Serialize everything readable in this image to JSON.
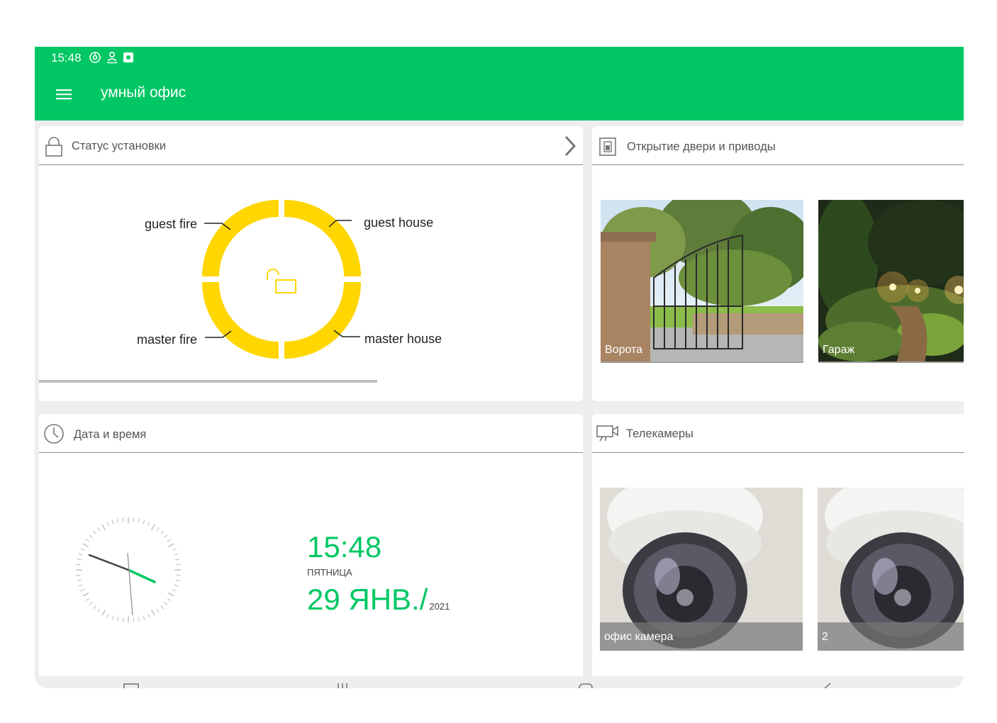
{
  "status_bar": {
    "time": "15:48",
    "icons": [
      "chrome-icon",
      "person-icon",
      "gallery-icon"
    ]
  },
  "app_bar": {
    "title": "умный офис",
    "menu_icon": "hamburger-menu-icon",
    "background": "#00c764"
  },
  "security_card": {
    "title": "Статус установки",
    "icon": "lock-icon",
    "chevron_icon": "chevron-right-icon",
    "ring_color": "#ffd600",
    "center_icon": "unlocked-padlock-icon",
    "zones": [
      "guest fire",
      "guest house",
      "master fire",
      "master house"
    ]
  },
  "doors_card": {
    "title": "Открытие двери и приводы",
    "icon": "door-icon",
    "tiles": [
      {
        "label": "Ворота"
      },
      {
        "label": "Гараж"
      }
    ]
  },
  "datetime_card": {
    "title": "Дата и время",
    "icon": "clock-icon",
    "time": "15:48",
    "weekday": "ПЯТНИЦА",
    "date": "29 ЯНВ./",
    "year": "2021",
    "accent": "#00c764"
  },
  "cameras_card": {
    "title": "Телекамеры",
    "icon": "video-camera-icon",
    "tiles": [
      {
        "label": "офис камера"
      },
      {
        "label": "2"
      }
    ]
  },
  "nav_bar": {
    "buttons": [
      "recent-apps-icon",
      "home-icon",
      "back-icon"
    ]
  }
}
